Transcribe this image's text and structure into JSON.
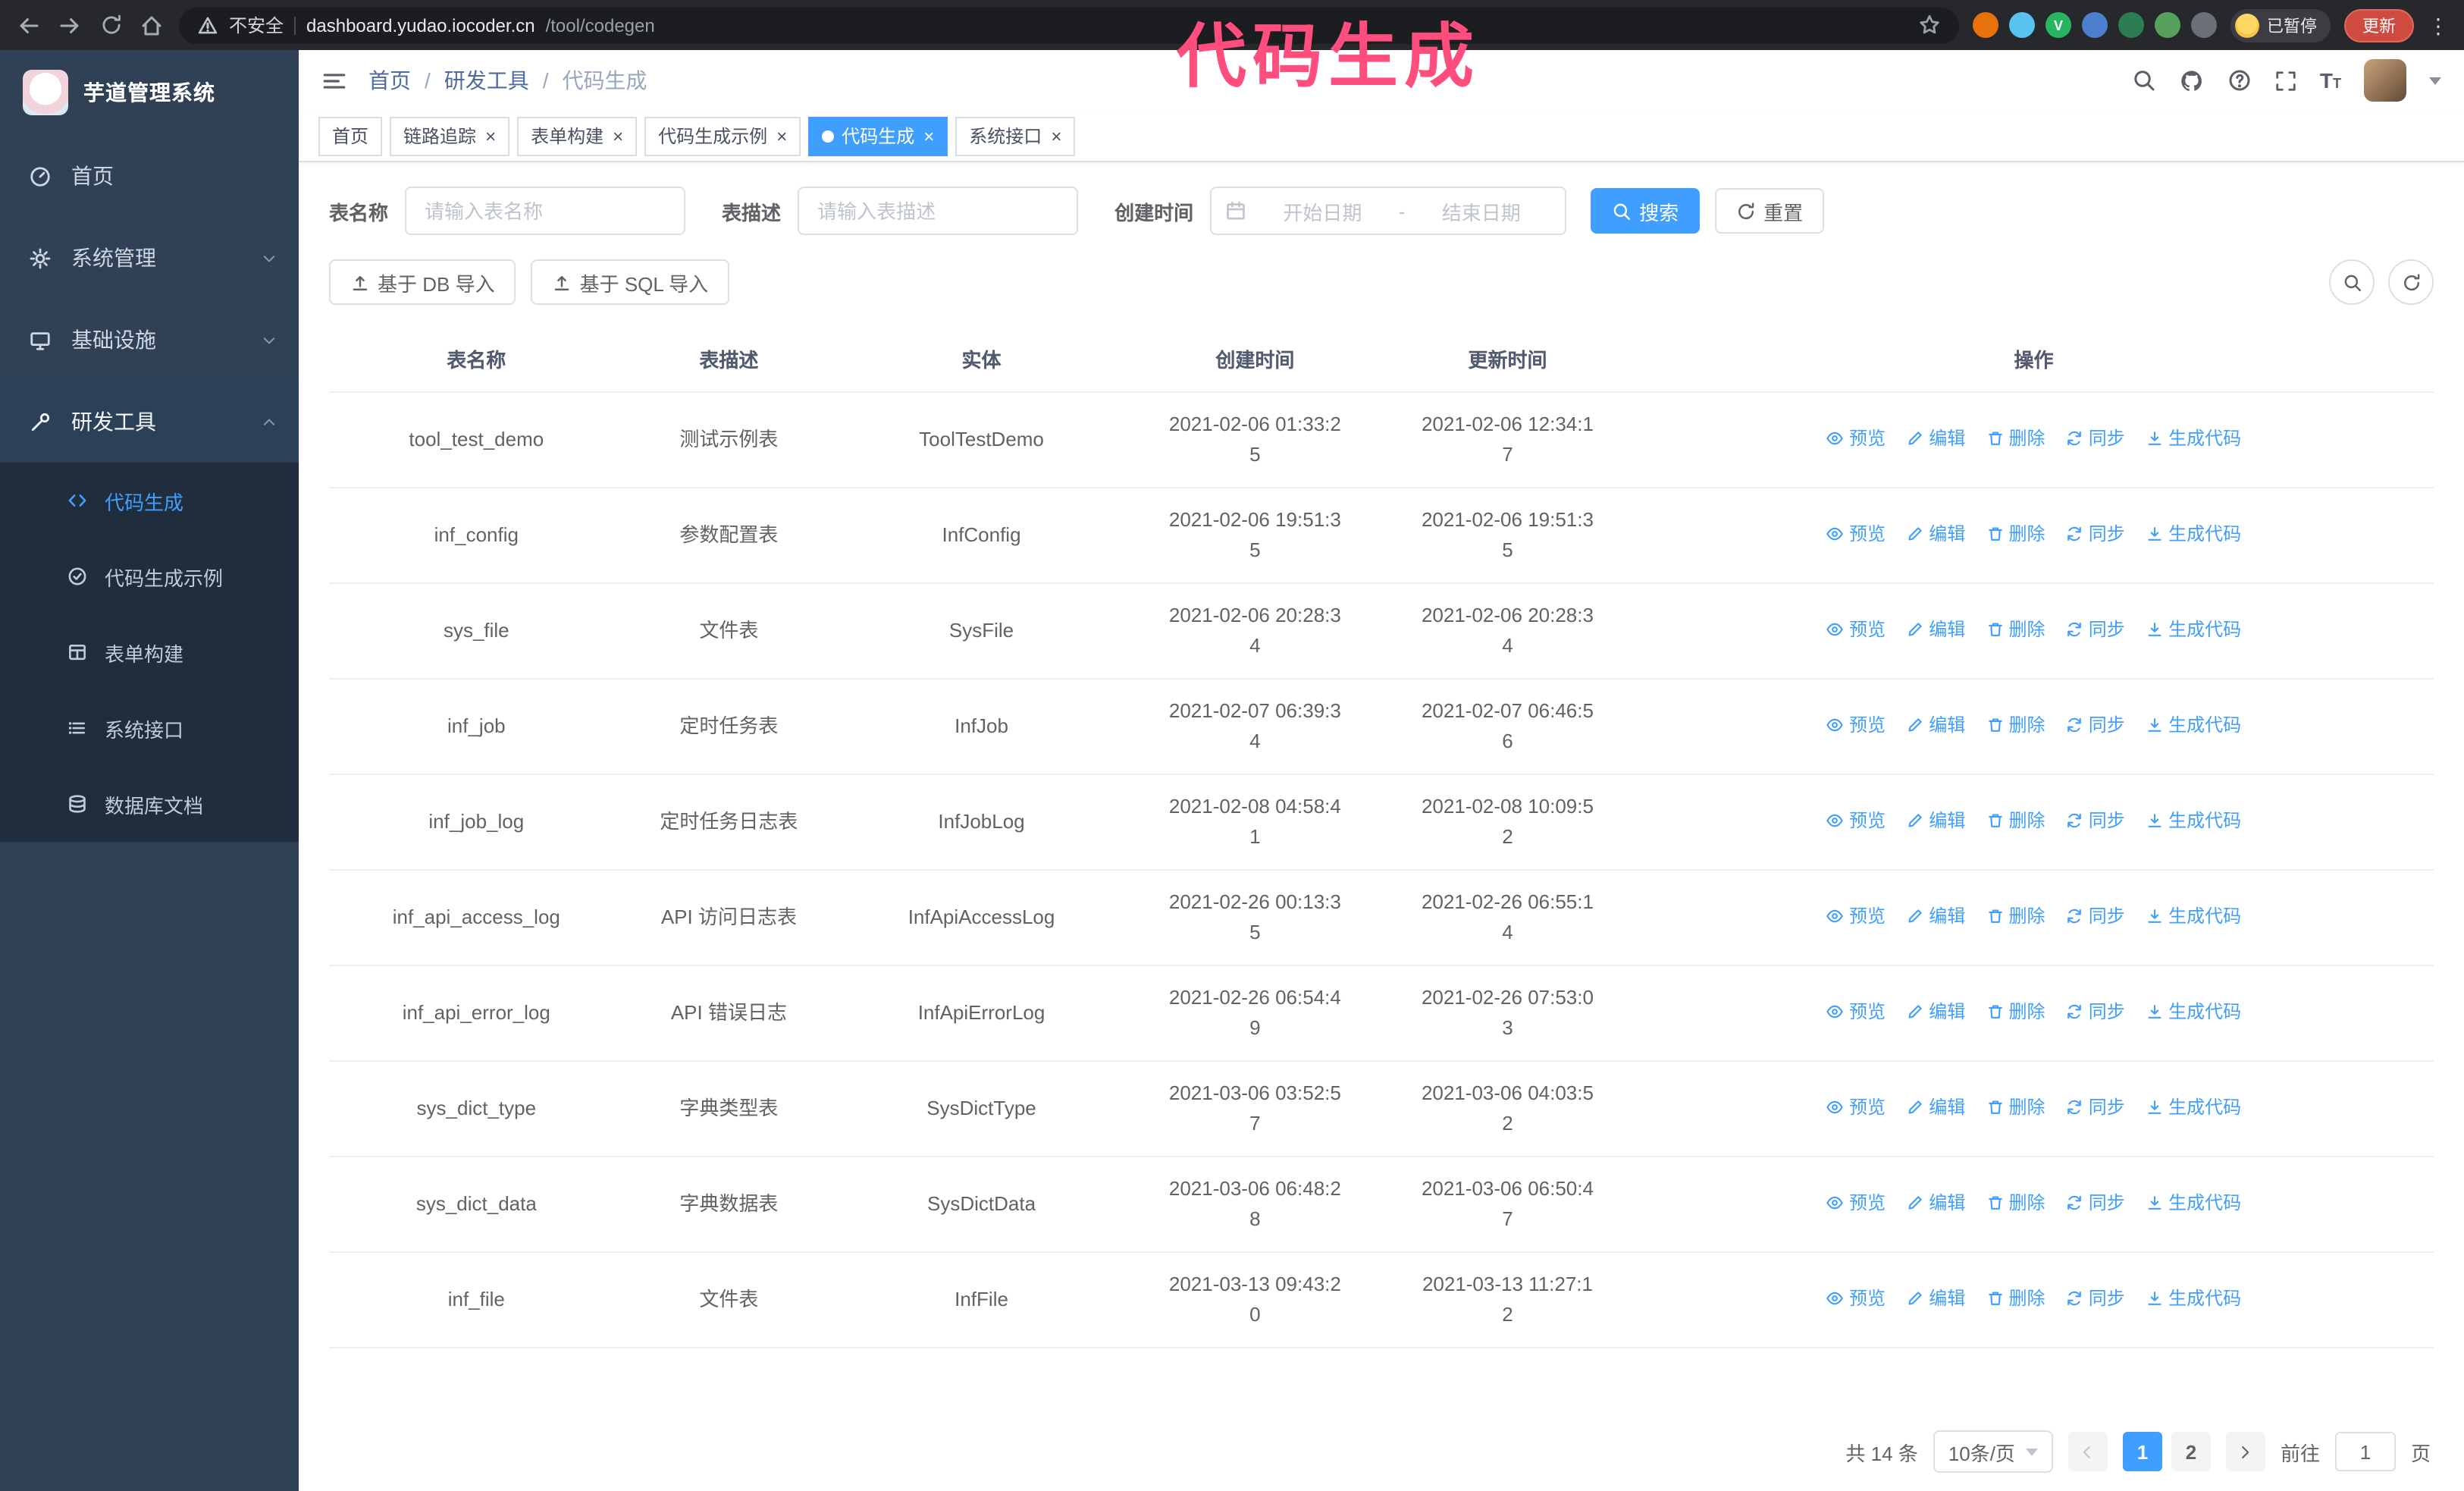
{
  "colors": {
    "accent": "#409EFF",
    "annotation_pink": "#FF4D7D",
    "sidebar_bg": "#304156",
    "submenu_bg": "#1F2D3D",
    "update_button_red": "#CF4A3F"
  },
  "browser": {
    "security_label": "不安全",
    "url_host": "dashboard.yudao.iocoder.cn",
    "url_path": "/tool/codegen",
    "profile_chip": "已暂停",
    "update_button": "更新",
    "extensions": [
      {
        "name": "orange-extension-icon",
        "color": "#e8710a"
      },
      {
        "name": "blue-drop-extension-icon",
        "color": "#58c2f0"
      },
      {
        "name": "green-check-extension-icon",
        "color": "#27b561",
        "glyph": "V"
      },
      {
        "name": "people-extension-icon",
        "color": "#4d7fd0"
      },
      {
        "name": "screen-extension-icon",
        "color": "#2e7d52"
      },
      {
        "name": "leaf-extension-icon",
        "color": "#57a15c"
      },
      {
        "name": "puzzle-extension-icon",
        "color": "#6b6f76"
      }
    ]
  },
  "annotation": {
    "text": "代码生成"
  },
  "sidebar": {
    "logo_title": "芋道管理系统",
    "items": [
      {
        "label": "首页"
      },
      {
        "label": "系统管理"
      },
      {
        "label": "基础设施"
      },
      {
        "label": "研发工具"
      }
    ],
    "submenu": [
      {
        "label": "代码生成"
      },
      {
        "label": "代码生成示例"
      },
      {
        "label": "表单构建"
      },
      {
        "label": "系统接口"
      },
      {
        "label": "数据库文档"
      }
    ]
  },
  "breadcrumb": [
    "首页",
    "研发工具",
    "代码生成"
  ],
  "tabs": [
    {
      "label": "首页",
      "closable": false,
      "active": false
    },
    {
      "label": "链路追踪",
      "closable": true,
      "active": false
    },
    {
      "label": "表单构建",
      "closable": true,
      "active": false
    },
    {
      "label": "代码生成示例",
      "closable": true,
      "active": false
    },
    {
      "label": "代码生成",
      "closable": true,
      "active": true
    },
    {
      "label": "系统接口",
      "closable": true,
      "active": false
    }
  ],
  "filters": {
    "table_name_label": "表名称",
    "table_name_placeholder": "请输入表名称",
    "table_desc_label": "表描述",
    "table_desc_placeholder": "请输入表描述",
    "create_time_label": "创建时间",
    "start_placeholder": "开始日期",
    "range_separator": "-",
    "end_placeholder": "结束日期",
    "search_button": "搜索",
    "reset_button": "重置"
  },
  "toolbar": {
    "import_db": "基于 DB 导入",
    "import_sql": "基于 SQL 导入"
  },
  "table": {
    "columns": [
      "表名称",
      "表描述",
      "实体",
      "创建时间",
      "更新时间",
      "操作"
    ],
    "actions": [
      {
        "label": "预览",
        "icon": "preview-eye-icon"
      },
      {
        "label": "编辑",
        "icon": "edit-pencil-icon"
      },
      {
        "label": "删除",
        "icon": "delete-trash-icon"
      },
      {
        "label": "同步",
        "icon": "sync-refresh-icon"
      },
      {
        "label": "生成代码",
        "icon": "generate-code-icon"
      }
    ],
    "rows": [
      {
        "name": "tool_test_demo",
        "desc": "测试示例表",
        "entity": "ToolTestDemo",
        "created": "2021-02-06 01:33:25",
        "updated": "2021-02-06 12:34:17"
      },
      {
        "name": "inf_config",
        "desc": "参数配置表",
        "entity": "InfConfig",
        "created": "2021-02-06 19:51:35",
        "updated": "2021-02-06 19:51:35"
      },
      {
        "name": "sys_file",
        "desc": "文件表",
        "entity": "SysFile",
        "created": "2021-02-06 20:28:34",
        "updated": "2021-02-06 20:28:34"
      },
      {
        "name": "inf_job",
        "desc": "定时任务表",
        "entity": "InfJob",
        "created": "2021-02-07 06:39:34",
        "updated": "2021-02-07 06:46:56"
      },
      {
        "name": "inf_job_log",
        "desc": "定时任务日志表",
        "entity": "InfJobLog",
        "created": "2021-02-08 04:58:41",
        "updated": "2021-02-08 10:09:52"
      },
      {
        "name": "inf_api_access_log",
        "desc": "API 访问日志表",
        "entity": "InfApiAccessLog",
        "created": "2021-02-26 00:13:35",
        "updated": "2021-02-26 06:55:14"
      },
      {
        "name": "inf_api_error_log",
        "desc": "API 错误日志",
        "entity": "InfApiErrorLog",
        "created": "2021-02-26 06:54:49",
        "updated": "2021-02-26 07:53:03"
      },
      {
        "name": "sys_dict_type",
        "desc": "字典类型表",
        "entity": "SysDictType",
        "created": "2021-03-06 03:52:57",
        "updated": "2021-03-06 04:03:52"
      },
      {
        "name": "sys_dict_data",
        "desc": "字典数据表",
        "entity": "SysDictData",
        "created": "2021-03-06 06:48:28",
        "updated": "2021-03-06 06:50:47"
      },
      {
        "name": "inf_file",
        "desc": "文件表",
        "entity": "InfFile",
        "created": "2021-03-13 09:43:20",
        "updated": "2021-03-13 11:27:12"
      }
    ]
  },
  "pagination": {
    "total_text": "共 14 条",
    "page_size": "10条/页",
    "pages": [
      "1",
      "2"
    ],
    "active_page": "1",
    "goto_label": "前往",
    "goto_value": "1",
    "goto_suffix": "页"
  }
}
